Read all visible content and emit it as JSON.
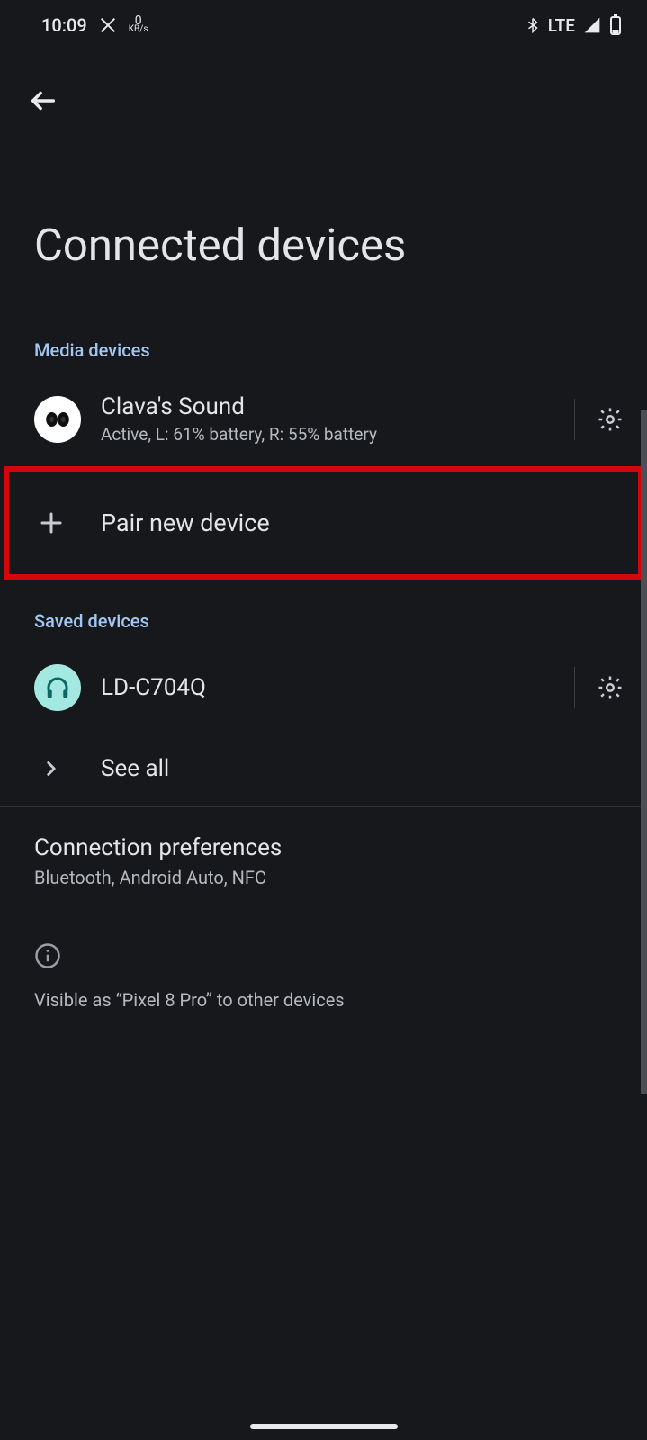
{
  "status": {
    "time": "10:09",
    "kbs_value": "0",
    "kbs_label": "KB/s",
    "network": "LTE"
  },
  "page": {
    "title": "Connected devices"
  },
  "media": {
    "header": "Media devices",
    "device": {
      "name": "Clava's Sound",
      "status": "Active, L: 61% battery, R: 55% battery"
    },
    "pair_label": "Pair new device"
  },
  "saved": {
    "header": "Saved devices",
    "device": {
      "name": "LD-C704Q"
    },
    "see_all": "See all"
  },
  "prefs": {
    "title": "Connection preferences",
    "subtitle": "Bluetooth, Android Auto, NFC"
  },
  "footer": {
    "visible_text": "Visible as “Pixel 8 Pro” to other devices"
  }
}
